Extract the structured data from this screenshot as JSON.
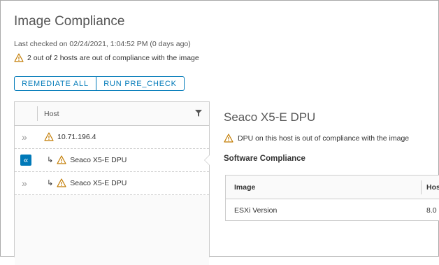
{
  "page": {
    "title": "Image Compliance",
    "last_checked": "Last checked on 02/24/2021, 1:04:52 PM (0 days ago)",
    "summary": "2 out of 2 hosts are out of compliance with the image"
  },
  "actions": {
    "remediate_all": "REMEDIATE ALL",
    "run_pre_check": "RUN PRE_CHECK"
  },
  "host_grid": {
    "column_header": "Host",
    "rows": [
      {
        "expand": "»",
        "child_marker": "",
        "label": "10.71.196.4",
        "selected": false
      },
      {
        "expand": "«",
        "child_marker": "↳",
        "label": "Seaco X5-E DPU",
        "selected": true
      },
      {
        "expand": "»",
        "child_marker": "↳",
        "label": "Seaco X5-E DPU",
        "selected": false
      }
    ]
  },
  "detail": {
    "title": "Seaco X5-E DPU",
    "warning": "DPU on this host is out of compliance with the image",
    "section_title": "Software Compliance",
    "table": {
      "headers": [
        "Image",
        "Hos"
      ],
      "rows": [
        [
          "ESXi Version",
          "8.0"
        ]
      ]
    }
  },
  "colors": {
    "accent": "#0079b8",
    "warning": "#c27b00",
    "text": "#333333",
    "border": "#cccccc"
  },
  "icons": {
    "warning": "warning-triangle-icon",
    "filter": "filter-icon",
    "expand": "double-chevron-right-icon",
    "collapse": "double-chevron-left-icon"
  }
}
